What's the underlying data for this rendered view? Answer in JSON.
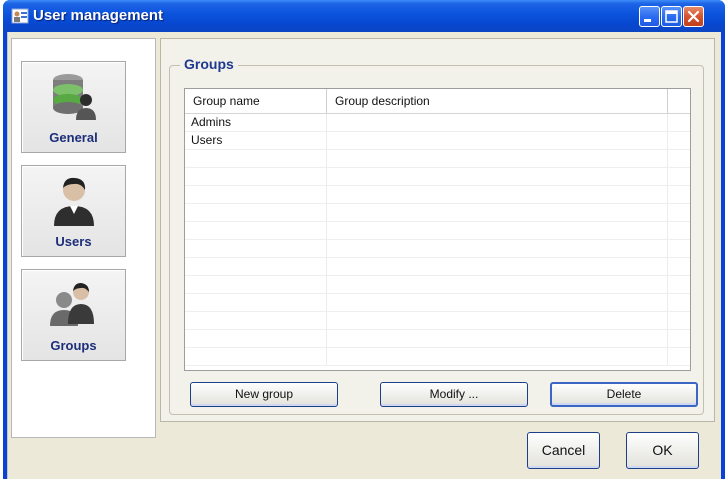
{
  "window": {
    "title": "User management",
    "icon": "user-management-app-icon",
    "controls": [
      "minimize-icon",
      "maximize-icon",
      "close-icon"
    ]
  },
  "nav": {
    "items": [
      {
        "label": "General",
        "icon": "database-user-icon"
      },
      {
        "label": "Users",
        "icon": "user-icon"
      },
      {
        "label": "Groups",
        "icon": "group-icon"
      }
    ]
  },
  "groups": {
    "title": "Groups",
    "columns": [
      "Group name",
      "Group description"
    ],
    "rows": [
      {
        "name": "Admins",
        "description": ""
      },
      {
        "name": "Users",
        "description": ""
      }
    ],
    "buttons": {
      "new": "New group",
      "modify": "Modify ...",
      "delete": "Delete"
    }
  },
  "footer": {
    "cancel": "Cancel",
    "ok": "OK"
  },
  "colors": {
    "titlebar": "#0b53dc",
    "nav_label": "#1c2e7a",
    "groupbox_title": "#1d3a8f",
    "button_border": "#1f3e8a"
  }
}
